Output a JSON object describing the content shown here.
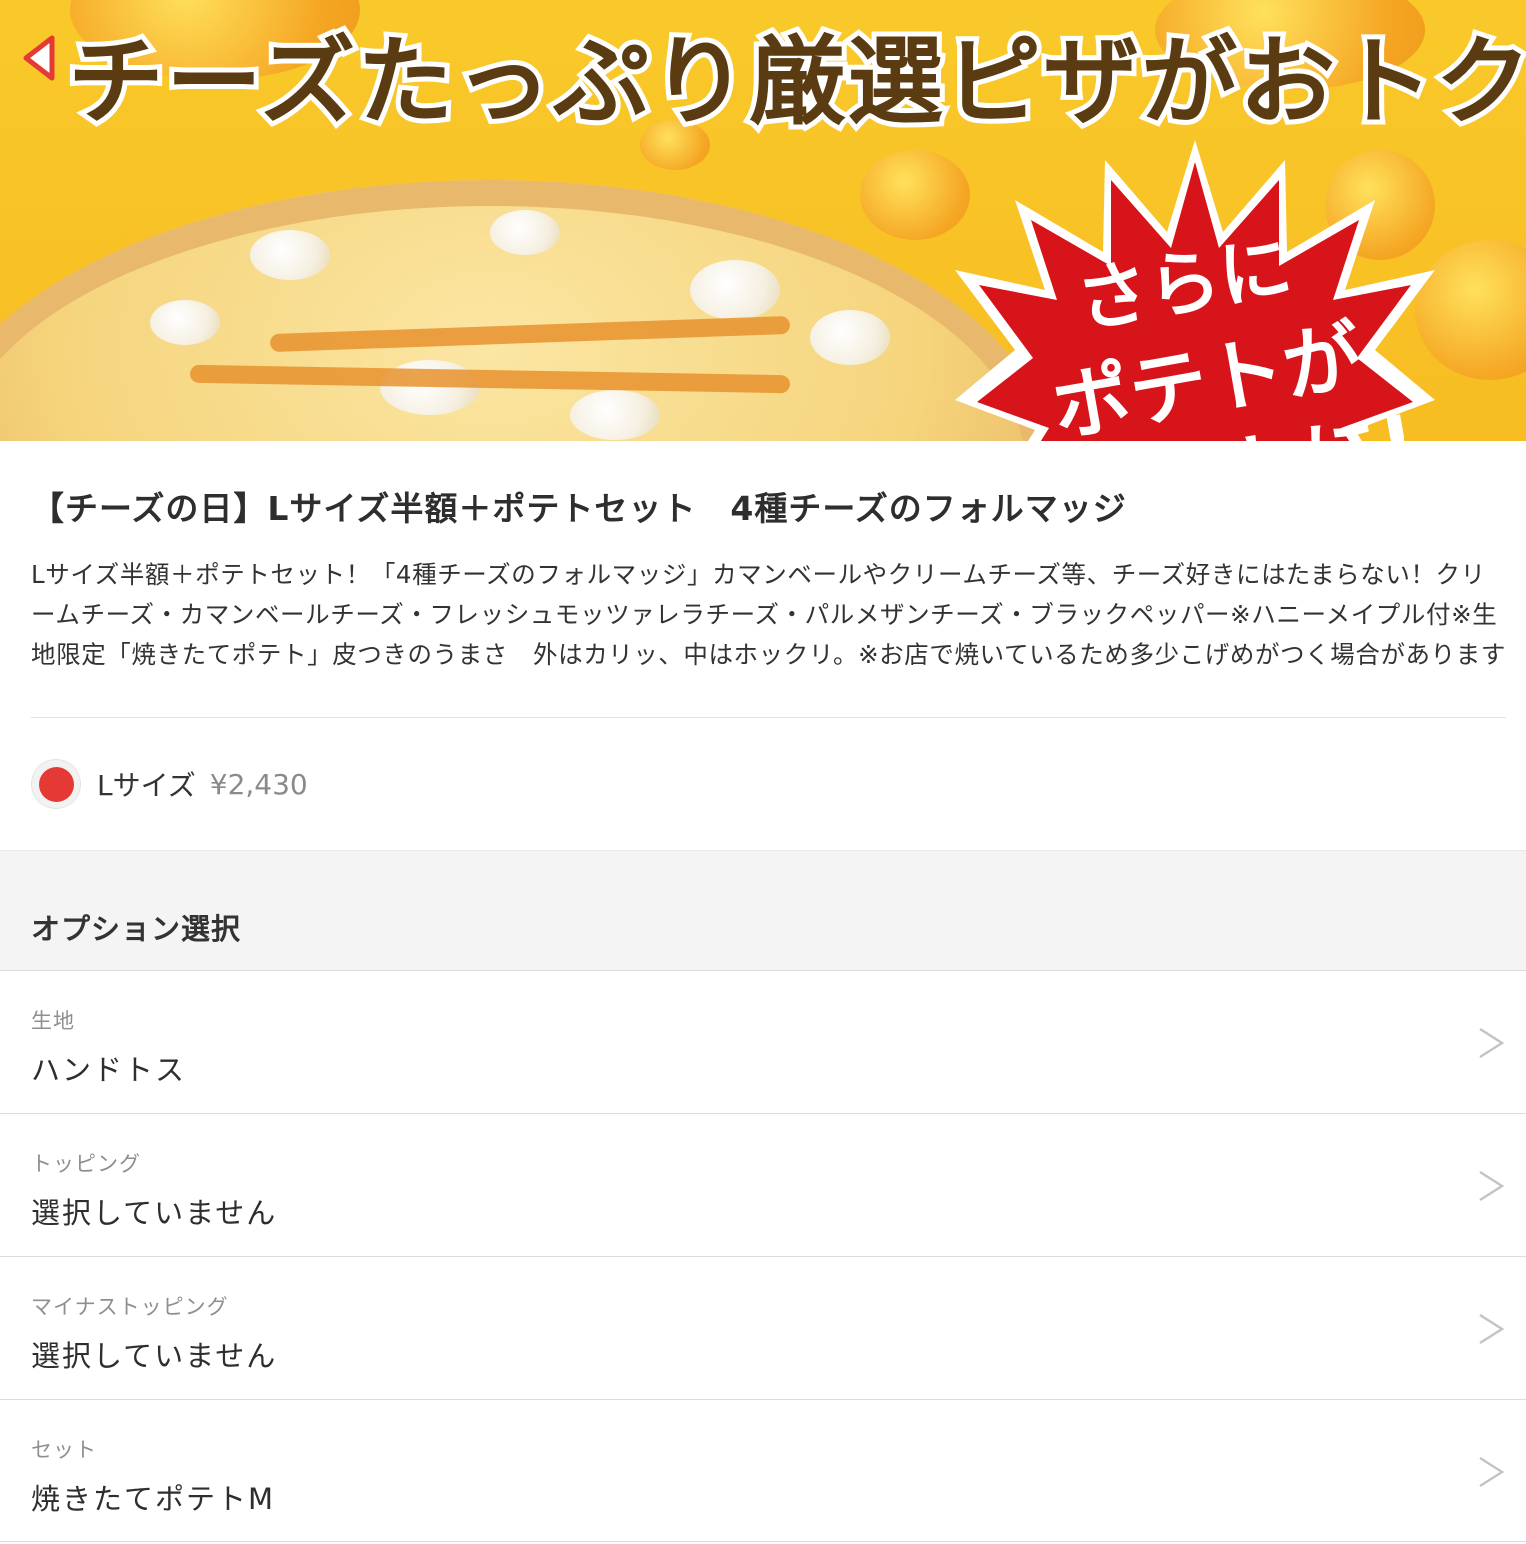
{
  "hero": {
    "headline": "チーズたっぷり厳選ピザがおトク!",
    "burst_line1": "さらに",
    "burst_line2": "ポテトが",
    "burst_line3": "セットに!",
    "brand_color": "#f9c92a",
    "burst_color": "#d7141a"
  },
  "product": {
    "title": "【チーズの日】Lサイズ半額＋ポテトセット　4種チーズのフォルマッジ",
    "description": "Lサイズ半額＋ポテトセット！「4種チーズのフォルマッジ」カマンベールやクリームチーズ等、チーズ好きにはたまらない！クリームチーズ・カマンベールチーズ・フレッシュモッツァレラチーズ・パルメザンチーズ・ブラックペッパー※ハニーメイプル付※生地限定「焼きたてポテト」皮つきのうまさ　外はカリッ、中はホックリ。※お店で焼いているため多少こげめがつく場合があります"
  },
  "size": {
    "label": "Lサイズ",
    "price": "¥2,430",
    "selected": true,
    "accent": "#e53935"
  },
  "options": {
    "section_title": "オプション選択",
    "items": [
      {
        "label": "生地",
        "value": "ハンドトス"
      },
      {
        "label": "トッピング",
        "value": "選択していません"
      },
      {
        "label": "マイナストッピング",
        "value": "選択していません"
      },
      {
        "label": "セット",
        "value": "焼きたてポテトM"
      }
    ]
  },
  "icons": {
    "back": "back-arrow-icon",
    "chevron": "chevron-right-icon"
  }
}
